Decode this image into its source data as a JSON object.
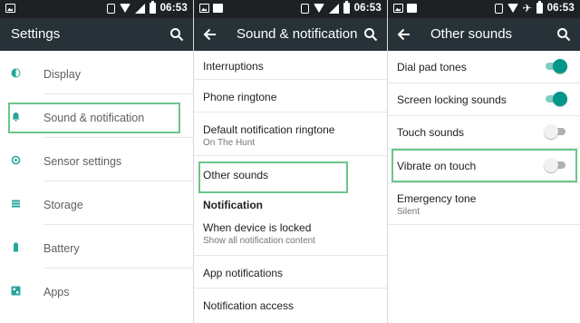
{
  "status": {
    "time": "06:53"
  },
  "panel1": {
    "title": "Settings",
    "items": [
      {
        "label": "Display",
        "icon": "brightness-icon"
      },
      {
        "label": "Sound & notification",
        "icon": "bell-icon"
      },
      {
        "label": "Sensor settings",
        "icon": "sensor-icon"
      },
      {
        "label": "Storage",
        "icon": "storage-icon"
      },
      {
        "label": "Battery",
        "icon": "battery-icon"
      },
      {
        "label": "Apps",
        "icon": "apps-icon"
      }
    ]
  },
  "panel2": {
    "title": "Sound & notification",
    "items": [
      {
        "label": "Interruptions"
      },
      {
        "label": "Phone ringtone"
      },
      {
        "label": "Default notification ringtone",
        "sub": "On The Hunt"
      },
      {
        "label": "Other sounds"
      },
      {
        "label": "Notification",
        "type": "section"
      },
      {
        "label": "When device is locked",
        "sub": "Show all notification content"
      },
      {
        "label": "App notifications"
      },
      {
        "label": "Notification access"
      }
    ]
  },
  "panel3": {
    "title": "Other sounds",
    "items": [
      {
        "label": "Dial pad tones",
        "toggle": "on"
      },
      {
        "label": "Screen locking sounds",
        "toggle": "on"
      },
      {
        "label": "Touch sounds",
        "toggle": "off"
      },
      {
        "label": "Vibrate on touch",
        "toggle": "off"
      },
      {
        "label": "Emergency tone",
        "sub": "Silent"
      }
    ]
  },
  "colors": {
    "statusbar": "#1e2124",
    "appbar": "#263238",
    "accent": "#009688",
    "highlight": "#6cc58c"
  }
}
